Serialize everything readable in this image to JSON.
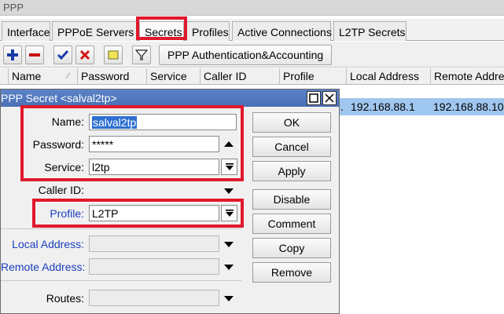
{
  "window": {
    "title": "PPP"
  },
  "tabs": [
    {
      "label": "Interface"
    },
    {
      "label": "PPPoE Servers"
    },
    {
      "label": "Secrets"
    },
    {
      "label": "Profiles"
    },
    {
      "label": "Active Connections"
    },
    {
      "label": "L2TP Secrets"
    }
  ],
  "toolbar": {
    "auth_button_label": "PPP Authentication&Accounting"
  },
  "grid": {
    "columns": [
      "Name",
      "Password",
      "Service",
      "Caller ID",
      "Profile",
      "Local Address",
      "Remote Address"
    ],
    "row": {
      "truncated": ".",
      "local_address": "192.168.88.1",
      "remote_address": "192.168.88.10"
    }
  },
  "dialog": {
    "title": "PPP Secret <salval2tp>",
    "labels": {
      "name": "Name:",
      "password": "Password:",
      "service": "Service:",
      "caller_id": "Caller ID:",
      "profile": "Profile:",
      "local_address": "Local Address:",
      "remote_address": "Remote Address:",
      "routes": "Routes:"
    },
    "values": {
      "name": "salval2tp",
      "password": "*****",
      "service": "l2tp",
      "caller_id": "",
      "profile": "L2TP",
      "local_address": "",
      "remote_address": "",
      "routes": ""
    },
    "buttons": {
      "ok": "OK",
      "cancel": "Cancel",
      "apply": "Apply",
      "disable": "Disable",
      "comment": "Comment",
      "copy": "Copy",
      "remove": "Remove"
    }
  },
  "colors": {
    "highlight_box": "#e0182d",
    "dialog_title": "#4a6fb5",
    "selected_row": "#9fc6ee",
    "blue_label": "#1a3dbd"
  },
  "icons": [
    "plus-icon",
    "minus-icon",
    "check-icon",
    "x-icon",
    "note-icon",
    "filter-icon",
    "maximize-icon",
    "close-icon",
    "dropdown-arrow-icon",
    "up-arrow-icon"
  ]
}
